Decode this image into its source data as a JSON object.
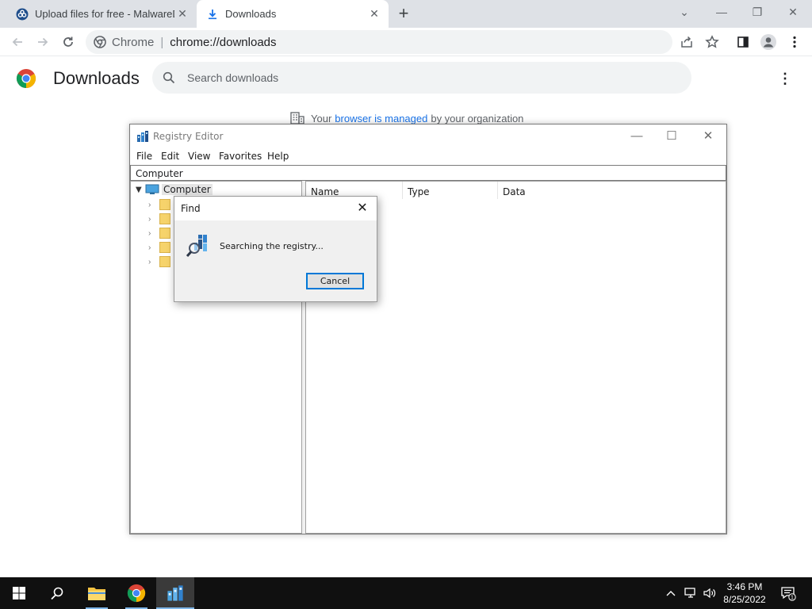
{
  "browser": {
    "tabs": [
      {
        "title": "Upload files for free - MalwareDa",
        "icon": "malwaredatabase-favicon"
      },
      {
        "title": "Downloads",
        "icon": "download-icon"
      }
    ],
    "omnibox": {
      "chip": "Chrome",
      "url": "chrome://downloads"
    }
  },
  "downloads_page": {
    "title": "Downloads",
    "search_placeholder": "Search downloads",
    "managed": {
      "prefix": "Your",
      "link": "browser is managed",
      "suffix": "by your organization"
    }
  },
  "registry_editor": {
    "title": "Registry Editor",
    "menu": [
      "File",
      "Edit",
      "View",
      "Favorites",
      "Help"
    ],
    "address": "Computer",
    "tree_root": "Computer",
    "columns": [
      "Name",
      "Type",
      "Data"
    ]
  },
  "find_dialog": {
    "title": "Find",
    "message": "Searching the registry...",
    "cancel_label": "Cancel"
  },
  "taskbar": {
    "time": "3:46 PM",
    "date": "8/25/2022",
    "notification_count": "1"
  },
  "colors": {
    "chrome_tabstrip": "#dee1e6",
    "link_blue": "#1a73e8",
    "dialog_focus_blue": "#0078d7",
    "taskbar": "#101010"
  }
}
